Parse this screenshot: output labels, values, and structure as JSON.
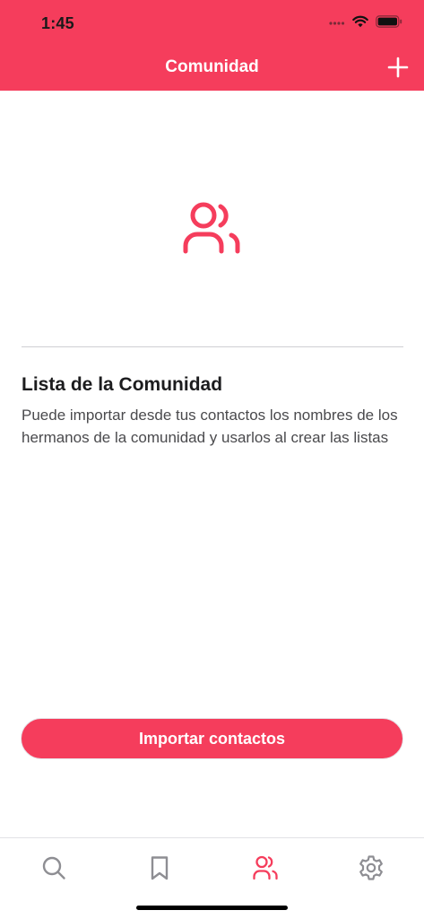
{
  "status_bar": {
    "time": "1:45"
  },
  "nav": {
    "title": "Comunidad",
    "add_icon": "plus-icon"
  },
  "hero": {
    "icon": "people-icon"
  },
  "section": {
    "title": "Lista de la Comunidad",
    "description": "Puede importar desde tus contactos los nombres de los hermanos de la comunidad y usarlos al crear las listas"
  },
  "actions": {
    "import_label": "Importar contactos"
  },
  "tab_bar": {
    "items": [
      {
        "icon": "search-icon",
        "active": false
      },
      {
        "icon": "bookmark-icon",
        "active": false
      },
      {
        "icon": "people-icon",
        "active": true
      },
      {
        "icon": "gear-icon",
        "active": false
      }
    ]
  },
  "colors": {
    "accent": "#f53d5c",
    "tab_inactive": "#8e8e93",
    "text_primary": "#1c1c1e",
    "text_secondary": "#4a4a4d"
  }
}
